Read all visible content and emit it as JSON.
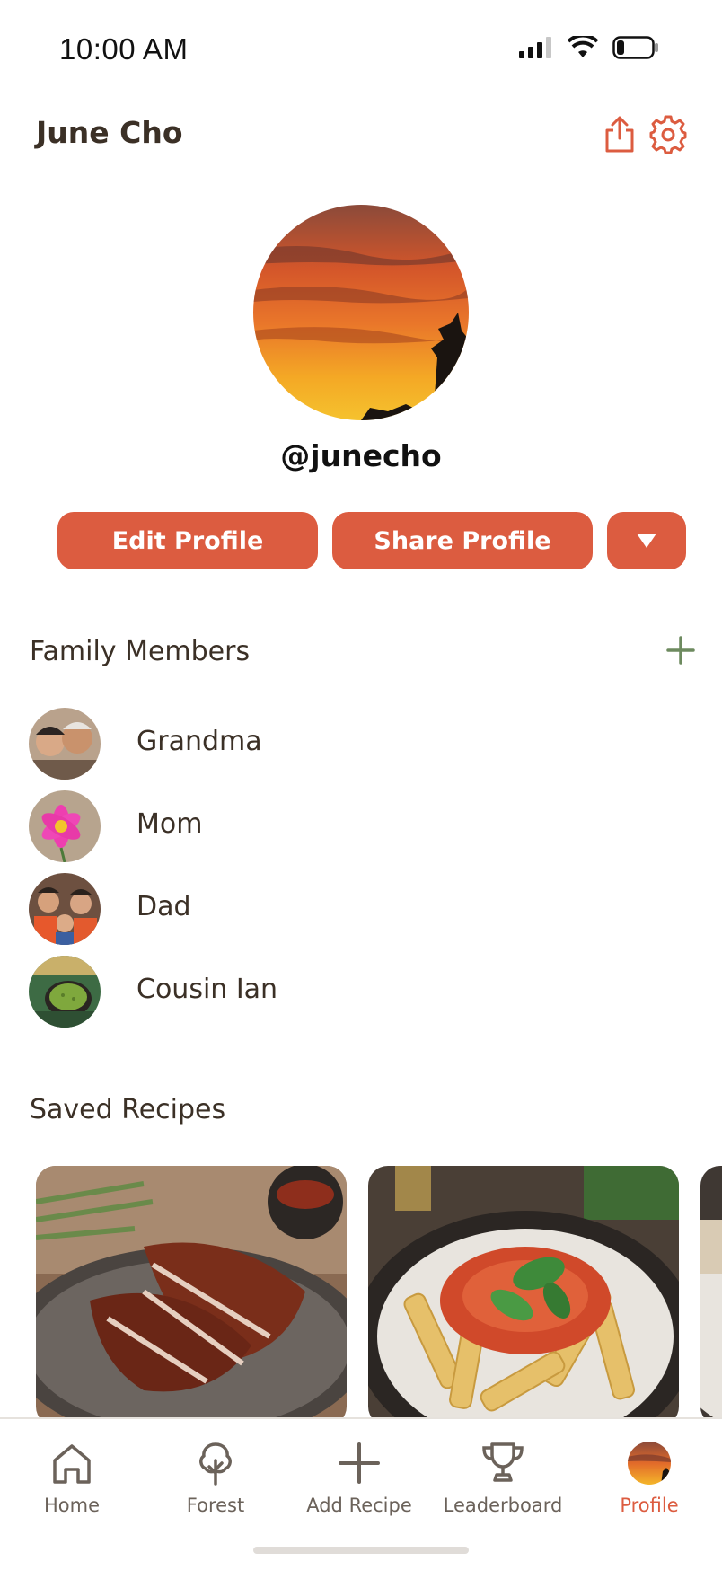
{
  "status_bar": {
    "time": "10:00 AM"
  },
  "header": {
    "title": "June Cho"
  },
  "profile": {
    "handle": "@junecho"
  },
  "actions": {
    "edit_label": "Edit Profile",
    "share_label": "Share Profile"
  },
  "family": {
    "title": "Family Members",
    "members": [
      {
        "name": "Grandma"
      },
      {
        "name": "Mom"
      },
      {
        "name": "Dad"
      },
      {
        "name": "Cousin Ian"
      }
    ]
  },
  "recipes": {
    "title": "Saved Recipes"
  },
  "tabs": [
    {
      "label": "Home"
    },
    {
      "label": "Forest"
    },
    {
      "label": "Add Recipe"
    },
    {
      "label": "Leaderboard"
    },
    {
      "label": "Profile",
      "active": true
    }
  ],
  "colors": {
    "accent": "#dc5c40",
    "text": "#3b3026",
    "add_green": "#6d8a5f"
  },
  "icons": [
    "signal-icon",
    "wifi-icon",
    "battery-icon",
    "share-icon",
    "gear-icon",
    "chevron-down-icon",
    "plus-icon",
    "home-icon",
    "tree-icon",
    "trophy-icon"
  ]
}
